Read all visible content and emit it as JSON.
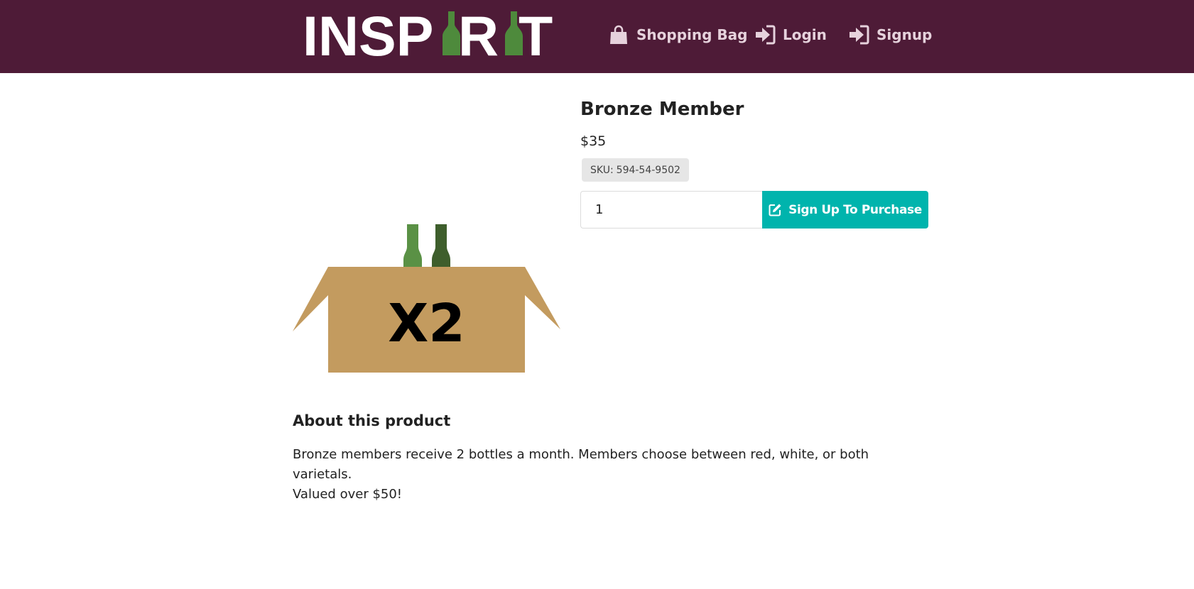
{
  "header": {
    "logo_text": "INSPIRIT",
    "nav": {
      "shopping_bag": "Shopping Bag",
      "login": "Login",
      "signup": "Signup"
    },
    "background_color": "#4e1b37",
    "nav_text_color": "#e6d2dc"
  },
  "product": {
    "title": "Bronze Member",
    "price": "$35",
    "sku_label": "SKU:",
    "sku_value": "594-54-9502",
    "quantity_value": "1",
    "purchase_button_label": "Sign Up To Purchase",
    "image_label": "X2",
    "accent_color": "#00b4ad"
  },
  "about": {
    "heading": "About this product",
    "text_line_1": "Bronze members receive 2 bottles a month. Members choose between red, white, or both varietals.",
    "text_line_2": "Valued over $50!"
  },
  "icons": {
    "shopping_bag": "shopping-bag-icon",
    "login": "sign-in-icon",
    "signup": "sign-in-icon",
    "purchase": "edit-icon"
  }
}
